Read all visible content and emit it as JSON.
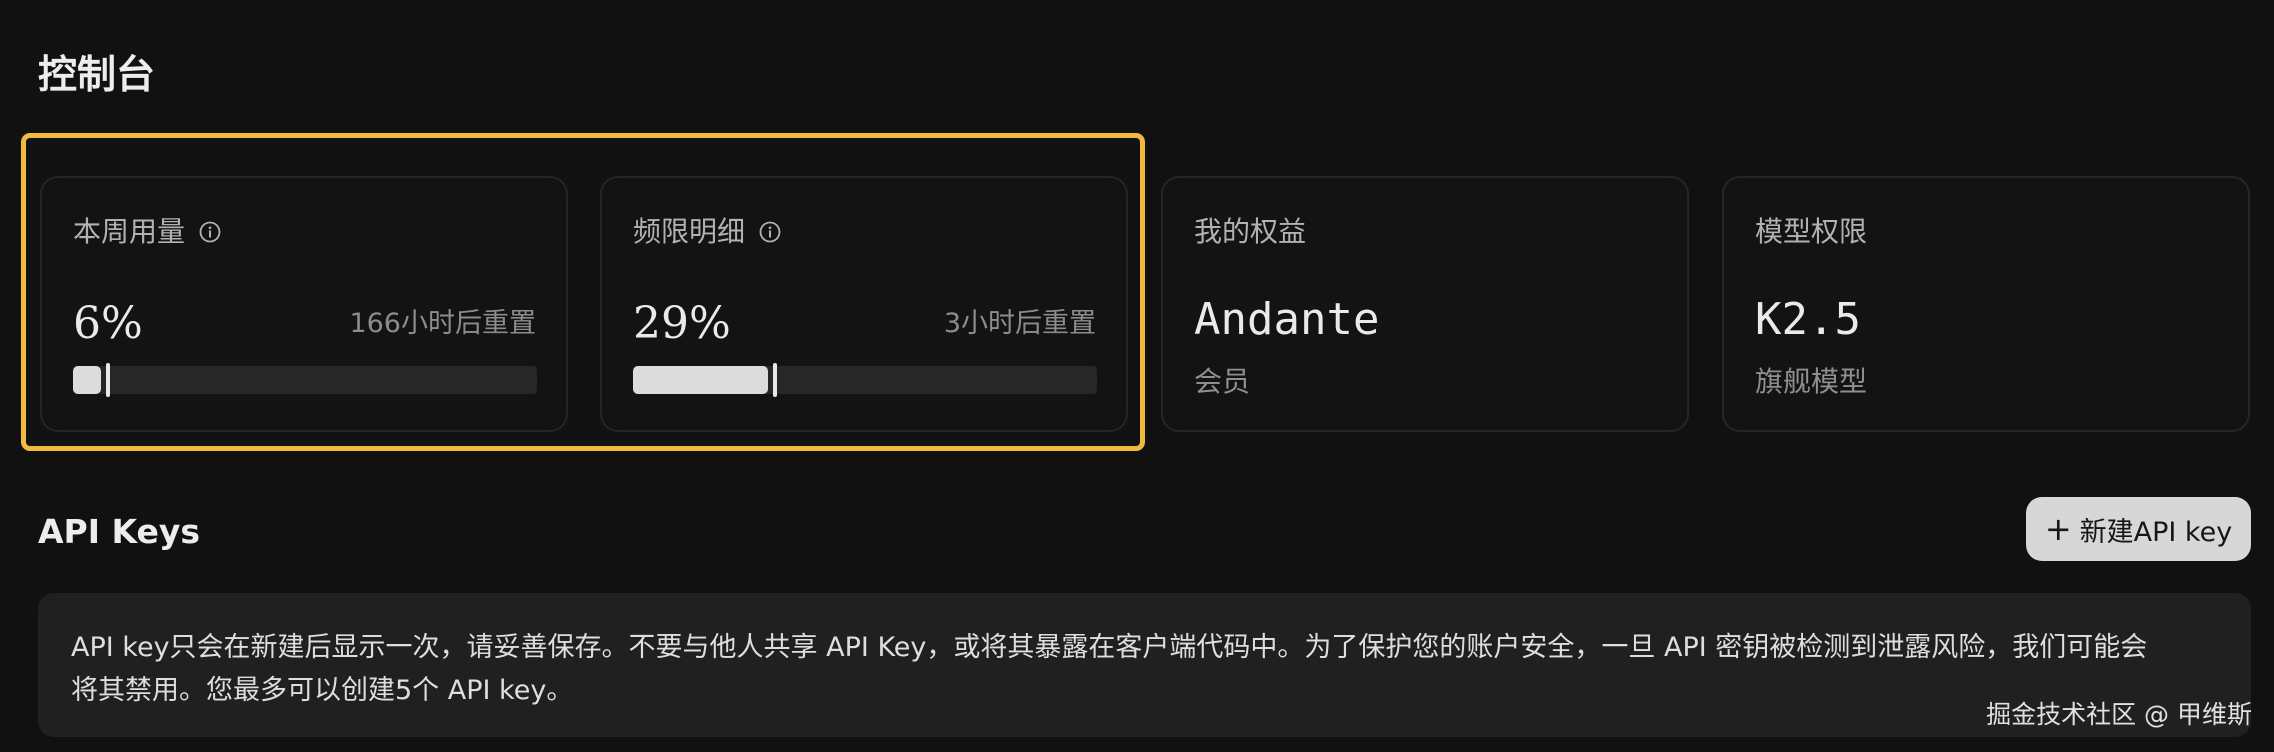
{
  "page": {
    "title": "控制台"
  },
  "cards": [
    {
      "title": "本周用量",
      "icon": "info-icon",
      "percent": "6%",
      "reset": "166小时后重置",
      "progress": 0.06
    },
    {
      "title": "频限明细",
      "icon": "info-icon",
      "percent": "29%",
      "reset": "3小时后重置",
      "progress": 0.29
    },
    {
      "title": "我的权益",
      "value": "Andante",
      "sub": "会员"
    },
    {
      "title": "模型权限",
      "value": "K2.5",
      "sub": "旗舰模型"
    }
  ],
  "api_keys": {
    "title": "API Keys",
    "new_button_label": "新建API key",
    "new_button_icon": "plus-icon",
    "notice_line1": "API key只会在新建后显示一次，请妥善保存。不要与他人共享 API Key，或将其暴露在客户端代码中。为了保护您的账户安全，一旦 API 密钥被检测到泄露风险，我们可能会",
    "notice_line2": "将其禁用。您最多可以创建5个 API key。"
  },
  "watermark": "掘金技术社区 @ 甲维斯",
  "colors": {
    "background": "#111111",
    "card_border": "#262626",
    "highlight": "#f2b940",
    "bar_fill": "#dcdcdc",
    "bar_track": "#272727",
    "button_bg": "#d7d7d7"
  }
}
